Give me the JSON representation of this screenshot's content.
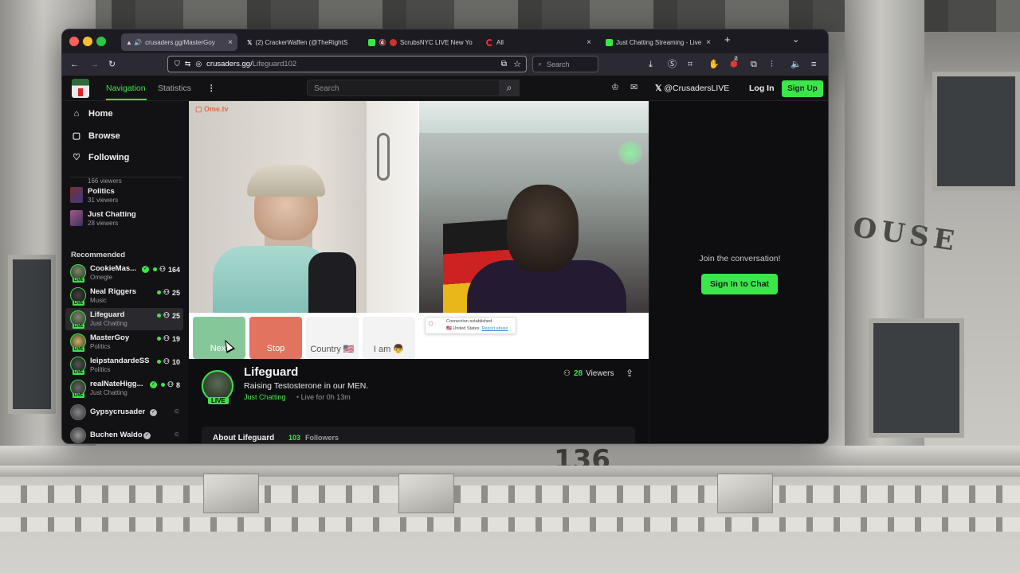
{
  "desktop": {
    "building_text": "OUSE",
    "address_number": "136"
  },
  "browser": {
    "tabs": [
      {
        "label": "crusaders.gg/MasterGoy",
        "active": true
      },
      {
        "label": "(2) CrackerWaffen (@TheRightS",
        "active": false
      },
      {
        "label": "ScrubsNYC LIVE New Yo",
        "active": false
      },
      {
        "label": "All",
        "active": false
      },
      {
        "label": "Just Chatting Streaming - Live",
        "active": false
      }
    ],
    "url_domain": "crusaders.gg/",
    "url_path": "Lifeguard102",
    "search_placeholder": "Search",
    "extension_badge": "2"
  },
  "site": {
    "nav": {
      "navigation": "Navigation",
      "statistics": "Statistics",
      "search_placeholder": "Search",
      "x_handle": "@CrusadersLIVE",
      "login": "Log In",
      "signup": "Sign Up"
    },
    "sidebar": {
      "main": [
        {
          "label": "Home",
          "icon": "home-icon"
        },
        {
          "label": "Browse",
          "icon": "browse-icon"
        },
        {
          "label": "Following",
          "icon": "heart-icon"
        }
      ],
      "partial_viewers": "166 viewers",
      "categories": [
        {
          "name": "Politics",
          "viewers": "31 viewers"
        },
        {
          "name": "Just Chatting",
          "viewers": "28 viewers"
        }
      ],
      "recommended_title": "Recommended",
      "streamers": [
        {
          "name": "CookieMas...",
          "game": "Omegle",
          "count": "164",
          "live": true,
          "verified": true
        },
        {
          "name": "Neal Riggers",
          "game": "Music",
          "count": "25",
          "live": true,
          "verified": false
        },
        {
          "name": "Lifeguard",
          "game": "Just Chatting",
          "count": "25",
          "live": true,
          "verified": false
        },
        {
          "name": "MasterGoy",
          "game": "Politics",
          "count": "19",
          "live": true,
          "verified": false
        },
        {
          "name": "leipstandardeSS",
          "game": "Politics",
          "count": "10",
          "live": true,
          "verified": false
        },
        {
          "name": "realNateHigg...",
          "game": "Just Chatting",
          "count": "8",
          "live": true,
          "verified": true
        },
        {
          "name": "Gypsycrusader",
          "game": "",
          "count": "",
          "live": false,
          "verified": true
        },
        {
          "name": "Buchen Waldo",
          "game": "",
          "count": "",
          "live": false,
          "verified": true
        }
      ]
    },
    "video": {
      "brand": "Ome.tv",
      "buttons": [
        {
          "label": "Next"
        },
        {
          "label": "Stop"
        },
        {
          "label": "Country 🇺🇸"
        },
        {
          "label": "I am 👦"
        }
      ],
      "connection_text": "Connection established",
      "connection_country": "United States.",
      "connection_link": "Report abuse"
    },
    "stream": {
      "name": "Lifeguard",
      "title": "Raising Testosterone in our MEN.",
      "category": "Just Chatting",
      "live_for": "Live for 0h 13m",
      "live_badge": "LIVE",
      "viewer_count": "28",
      "viewer_label": "Viewers",
      "about_label": "About Lifeguard",
      "followers_count": "103",
      "followers_label": "Followers"
    },
    "chat": {
      "prompt": "Join the conversation!",
      "button": "Sign In to Chat"
    },
    "colors": {
      "accent": "#3be64a",
      "background": "#0e0e10",
      "stop_button": "#e2735f",
      "next_button": "#86c79a"
    }
  }
}
